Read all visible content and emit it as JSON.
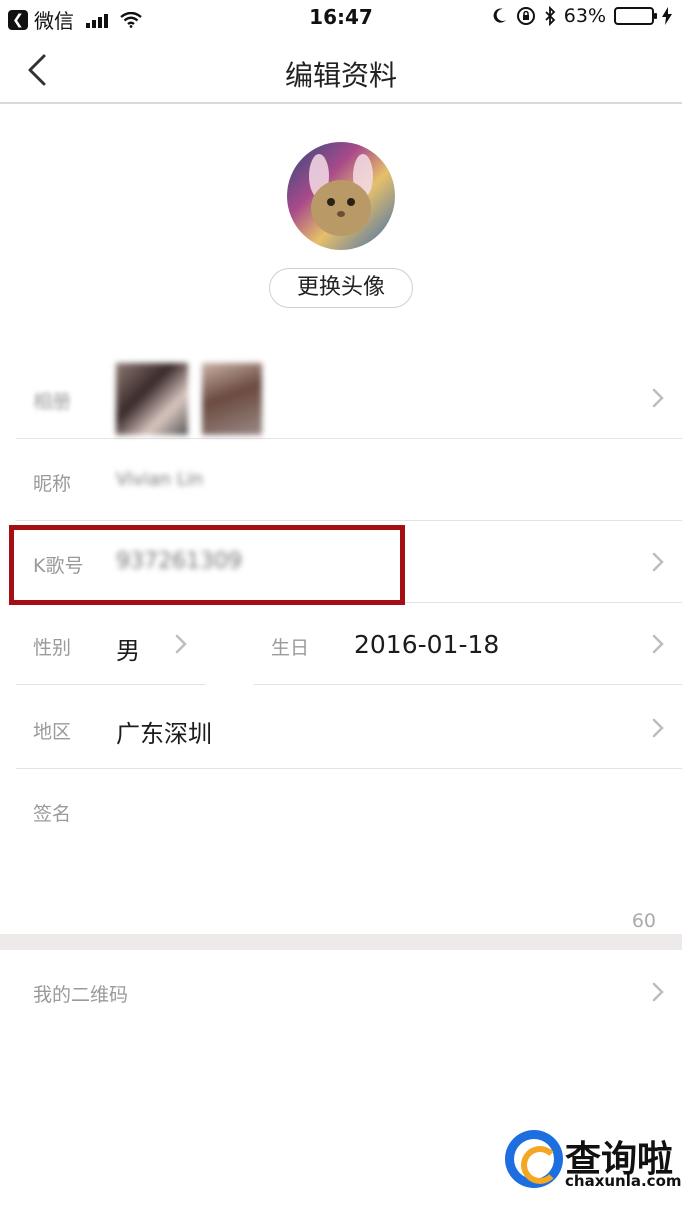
{
  "status_bar": {
    "carrier": "微信",
    "time": "16:47",
    "battery": "63%",
    "battery_level": 0.63
  },
  "nav": {
    "title": "编辑资料",
    "back_icon": "chevron-left-icon"
  },
  "avatar": {
    "change_label": "更换头像"
  },
  "rows": {
    "album": {
      "label": "相册"
    },
    "nickname": {
      "label": "昵称",
      "value": "Vivian Lin"
    },
    "kid": {
      "label": "K歌号",
      "value": "937261309"
    },
    "gender": {
      "label": "性别",
      "value": "男"
    },
    "birthday": {
      "label": "生日",
      "value": "2016-01-18"
    },
    "region": {
      "label": "地区",
      "value": "广东深圳"
    },
    "signature": {
      "label": "签名",
      "remaining": "60"
    },
    "qrcode": {
      "label": "我的二维码"
    }
  },
  "watermark": {
    "title": "查询啦",
    "subtitle": "chaxunla.com"
  },
  "colors": {
    "highlight": "#a50f14",
    "battery_fill": "#4cd964",
    "label_gray": "#9a9a9a"
  }
}
